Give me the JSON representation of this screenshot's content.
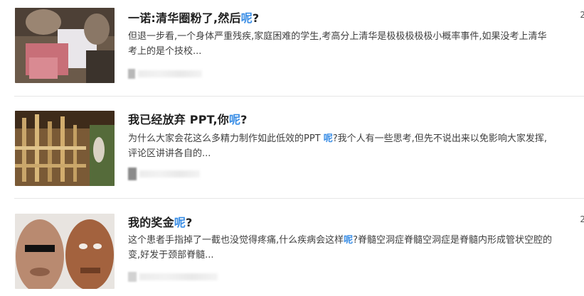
{
  "results": [
    {
      "title_pre": "一诺:清华圈粉了,然后",
      "title_kw": "呢",
      "title_post": "?",
      "snippet_line1": "但退一步看,一个身体严重残疾,家庭困难的学生,考高分上清华是极极极极极小概率事件,如果没考上清华",
      "snippet_line2": "考上的是个技校...",
      "date": "2"
    },
    {
      "title_pre": "我已经放弃 PPT,你",
      "title_kw": "呢",
      "title_post": "?",
      "snippet_pre": "为什么大家会花这么多精力制作如此低效的PPT ",
      "snippet_kw": "呢",
      "snippet_post": "?我个人有一些思考,但先不说出来以免影响大家发挥,",
      "snippet_line2": "评论区讲讲各自的...",
      "date": ""
    },
    {
      "title_pre": "我的奖金",
      "title_kw": "呢",
      "title_post": "?",
      "snippet_pre": "这个患者手指掉了一截也没觉得疼痛,什么疾病会这样",
      "snippet_kw": "呢",
      "snippet_post": "?脊髓空洞症脊髓空洞症是脊髓内形成管状空腔的",
      "snippet_line2": "变,好发于颈部脊髓...",
      "date": "2"
    }
  ]
}
